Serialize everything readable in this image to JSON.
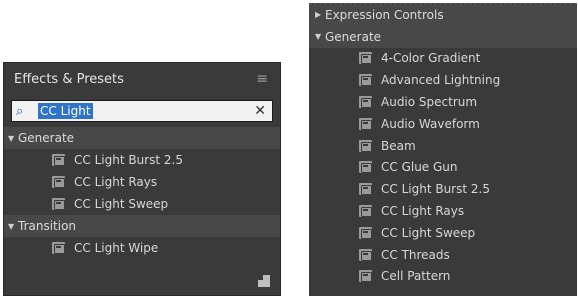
{
  "left_panel": {
    "title": "Effects & Presets",
    "search": {
      "query": "CC Light"
    },
    "tree": [
      {
        "kind": "category",
        "label": "Generate",
        "expanded": true
      },
      {
        "kind": "effect",
        "label": "CC Light Burst 2.5"
      },
      {
        "kind": "effect",
        "label": "CC Light Rays"
      },
      {
        "kind": "effect",
        "label": "CC Light Sweep"
      },
      {
        "kind": "category",
        "label": "Transition",
        "expanded": true
      },
      {
        "kind": "effect",
        "label": "CC Light Wipe"
      }
    ]
  },
  "right_panel": {
    "tree": [
      {
        "kind": "category",
        "label": "Expression Controls",
        "expanded": false
      },
      {
        "kind": "category",
        "label": "Generate",
        "expanded": true
      },
      {
        "kind": "effect",
        "label": "4-Color Gradient"
      },
      {
        "kind": "effect",
        "label": "Advanced Lightning"
      },
      {
        "kind": "effect",
        "label": "Audio Spectrum"
      },
      {
        "kind": "effect",
        "label": "Audio Waveform"
      },
      {
        "kind": "effect",
        "label": "Beam"
      },
      {
        "kind": "effect",
        "label": "CC Glue Gun"
      },
      {
        "kind": "effect",
        "label": "CC Light Burst 2.5"
      },
      {
        "kind": "effect",
        "label": "CC Light Rays"
      },
      {
        "kind": "effect",
        "label": "CC Light Sweep"
      },
      {
        "kind": "effect",
        "label": "CC Threads"
      },
      {
        "kind": "effect",
        "label": "Cell Pattern"
      }
    ]
  }
}
